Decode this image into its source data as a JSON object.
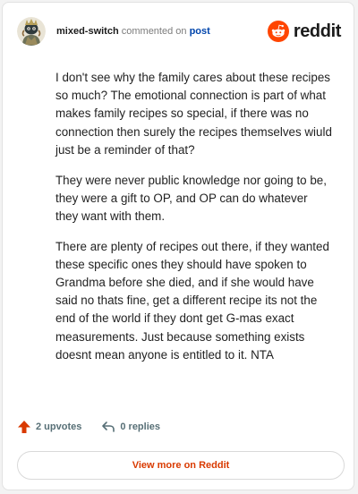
{
  "comment": {
    "author": "mixed-switch",
    "action_text": "commented on",
    "post_link_text": "post",
    "avatar_icon": "snoo-avatar-icon",
    "paragraphs": [
      "I don't see why the family cares about these recipes so much? The emotional connection is part of what makes family recipes so special, if there was no connection then surely the recipes themselves wiuld just be a reminder of that?",
      "They were never public knowledge nor going to be, they were a gift to OP, and OP can do whatever they want with them.",
      "There are plenty of recipes out there, if they wanted these specific ones they should have spoken to Grandma before she died, and if she would have said no thats fine, get a different recipe its not the end of the world if they dont get G-mas exact measurements. Just because something exists doesnt mean anyone is entitled to it. NTA"
    ]
  },
  "brand": {
    "name": "reddit",
    "icon": "reddit-logo-icon",
    "color": "#ff4500"
  },
  "footer": {
    "upvotes_label": "2 upvotes",
    "upvote_icon": "upvote-arrow-icon",
    "upvote_color": "#d93a00",
    "replies_label": "0 replies",
    "reply_icon": "reply-arrow-icon"
  },
  "view_more_label": "View more on Reddit"
}
